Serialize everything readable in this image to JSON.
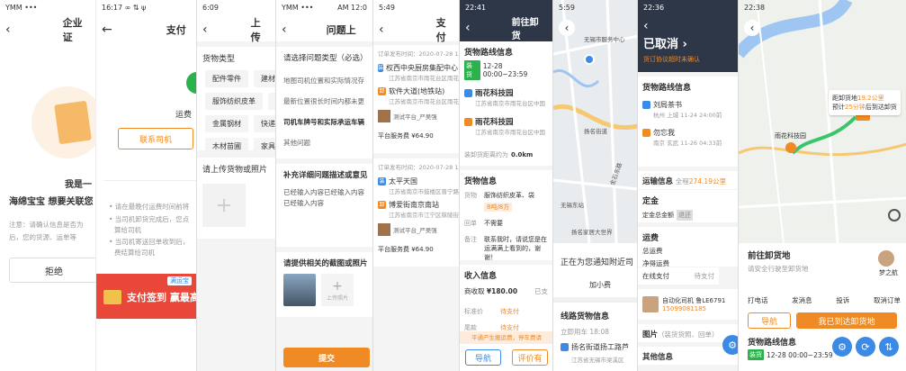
{
  "p1": {
    "status": "YMM •••",
    "title": "企业证",
    "q1": "我是一",
    "q2": "海绵宝宝 想要关联您",
    "note1": "注意：请确认信息是否为",
    "note2": "后，您的货源、运单等",
    "reject": "拒绝"
  },
  "p2": {
    "status": "16:17 ∞ ⇅ ψ",
    "title": "支付",
    "freight": "运费",
    "contact": "联系司机",
    "b1": "• 请在最晚付运费时间前将",
    "b2": "• 当司机卸货完成后，您点",
    "b2b": "算给司机",
    "b3": "• 当司机寄送回单收到后，",
    "b3b": "费结算给司机",
    "banner_tag": "满运宝",
    "banner": "支付签到 赢最高"
  },
  "p3": {
    "status": "6:09",
    "title": "上传",
    "cargo_type": "货物类型",
    "chips": [
      "配件零件",
      "建材",
      "服饰纺织皮革",
      "食",
      "金属钢材",
      "快递行",
      "木材苗圃",
      "家具家"
    ],
    "upload": "请上传货物或照片"
  },
  "p4": {
    "status": "YMM •••",
    "time": "AM 12:0",
    "title": "问题上",
    "q": "请选择问题类型（必选）",
    "opts": [
      "地图司机位置和实际情况存",
      "最新位置很长时间内都未更",
      "司机车牌号和实际承运车辆",
      "其他问题"
    ],
    "detail": "补充详细问题描述或意见",
    "detail_text": "已经输入内容已经输入内容已经输入内容",
    "pic": "请提供相关的截图或照片",
    "upload_pic": "上传照片",
    "submit": "提交"
  },
  "p5": {
    "status": "5:49",
    "title": "支付",
    "orders": [
      {
        "time": "订单发布时间：2020-07-28 17:48",
        "from": "权西中央厨房集配中心",
        "from_addr": "江苏省南京市雨花台区雨花",
        "to": "软件大道(地铁站)",
        "to_addr": "江苏省南京市雨花台区雨花",
        "company": "测试平台_严吴强",
        "fee": "平台服务费 ¥64.90"
      },
      {
        "time": "订单发布时间：2020-07-28 17:48",
        "from": "太平天国",
        "from_addr": "江苏省南京市鼓楼区晋宁路",
        "to": "博爱街南京南站",
        "to_addr": "江苏省南京市江宁区秣陵街",
        "company": "测试平台_严吴强",
        "fee": "平台服务费 ¥64.90"
      }
    ]
  },
  "p6": {
    "status": "22:41",
    "title": "前往卸货",
    "route": "货物路线信息",
    "badge": "装货",
    "date": "12-28 00:00~23:59",
    "from": "雨花科技园",
    "from_addr": "江苏省南京市雨花台区中国",
    "to": "雨花科技园",
    "to_addr": "江苏省南京市雨花台区中国",
    "dist_label": "装卸货距离约为",
    "dist": "0.0km",
    "cargo": "货物信息",
    "goods_k": "货物",
    "goods_v": "服饰纺织皮革、袋",
    "goods_sub": "8吨/8方",
    "recv_k": "回单",
    "recv_v": "不需要",
    "remark_k": "备注",
    "remark_v": "联系我时，请说您是在运满满上看到的，谢谢！",
    "income": "收入信息",
    "fee_k": "商收取",
    "fee_v": "¥180.00",
    "paid": "已支",
    "mid_k": "标准价",
    "mid_v": "待支付",
    "tail_k": "尾款",
    "tail_v": "待支付",
    "promo": "平通产生搬运费，停车费请",
    "nav": "导航",
    "review": "评价有"
  },
  "p7": {
    "status": "5:59",
    "place1": "无锡市服务中心",
    "place2": "扬名街道",
    "place3": "无锡东站",
    "place4": "金石东路",
    "place5": "扬名家居大世界",
    "notify": "正在为您通知附近司",
    "add_tip": "加小费",
    "route": "线路货物信息",
    "load_time": "立即用车 18:08",
    "from": "扬名街道扬工路芦",
    "from_addr": "江苏省无锡市梁溪区"
  },
  "p8": {
    "status": "22:36",
    "title": "已取消",
    "sub": "货订协议超时未确认",
    "route": "货物路线信息",
    "from": "刘局茶书",
    "from_addr": "杭州 上城 11-24 24:00前",
    "to": "勿忘我",
    "to_addr": "南京 玄武 11-26 04:33前",
    "ship": "运输信息",
    "total_label": "全程",
    "total": "274.19公里",
    "deposit": "定金",
    "deposit_v": "定金总金额",
    "deposit_tag": "退还",
    "freight": "运费",
    "total_fee": "总运费",
    "net_fee": "净得运费",
    "online": "在线支付",
    "tail": "待支付",
    "driver": "自动化司机 鲁LE6791",
    "phone": "15099081185",
    "img": "图片",
    "img_sub": "（装货货照、回单）",
    "other": "其他信息"
  },
  "p9": {
    "status": "22:38",
    "dist_line1_a": "距卸货地",
    "dist_line1_b": "19.2公里",
    "dist_line2_a": "预计",
    "dist_line2_b": "25分钟",
    "dist_line2_c": "后到达卸货",
    "park": "雨花科技园",
    "heading": "前往卸货地",
    "sub": "请安全行驶至卸货地",
    "driver": "梦之航",
    "actions": [
      "打电话",
      "发消息",
      "投诉",
      "取消订单"
    ],
    "nav": "导航",
    "arrived": "我已到达卸货地",
    "route": "货物路线信息",
    "badge": "装货",
    "date": "12-28 00:00~23:59"
  }
}
